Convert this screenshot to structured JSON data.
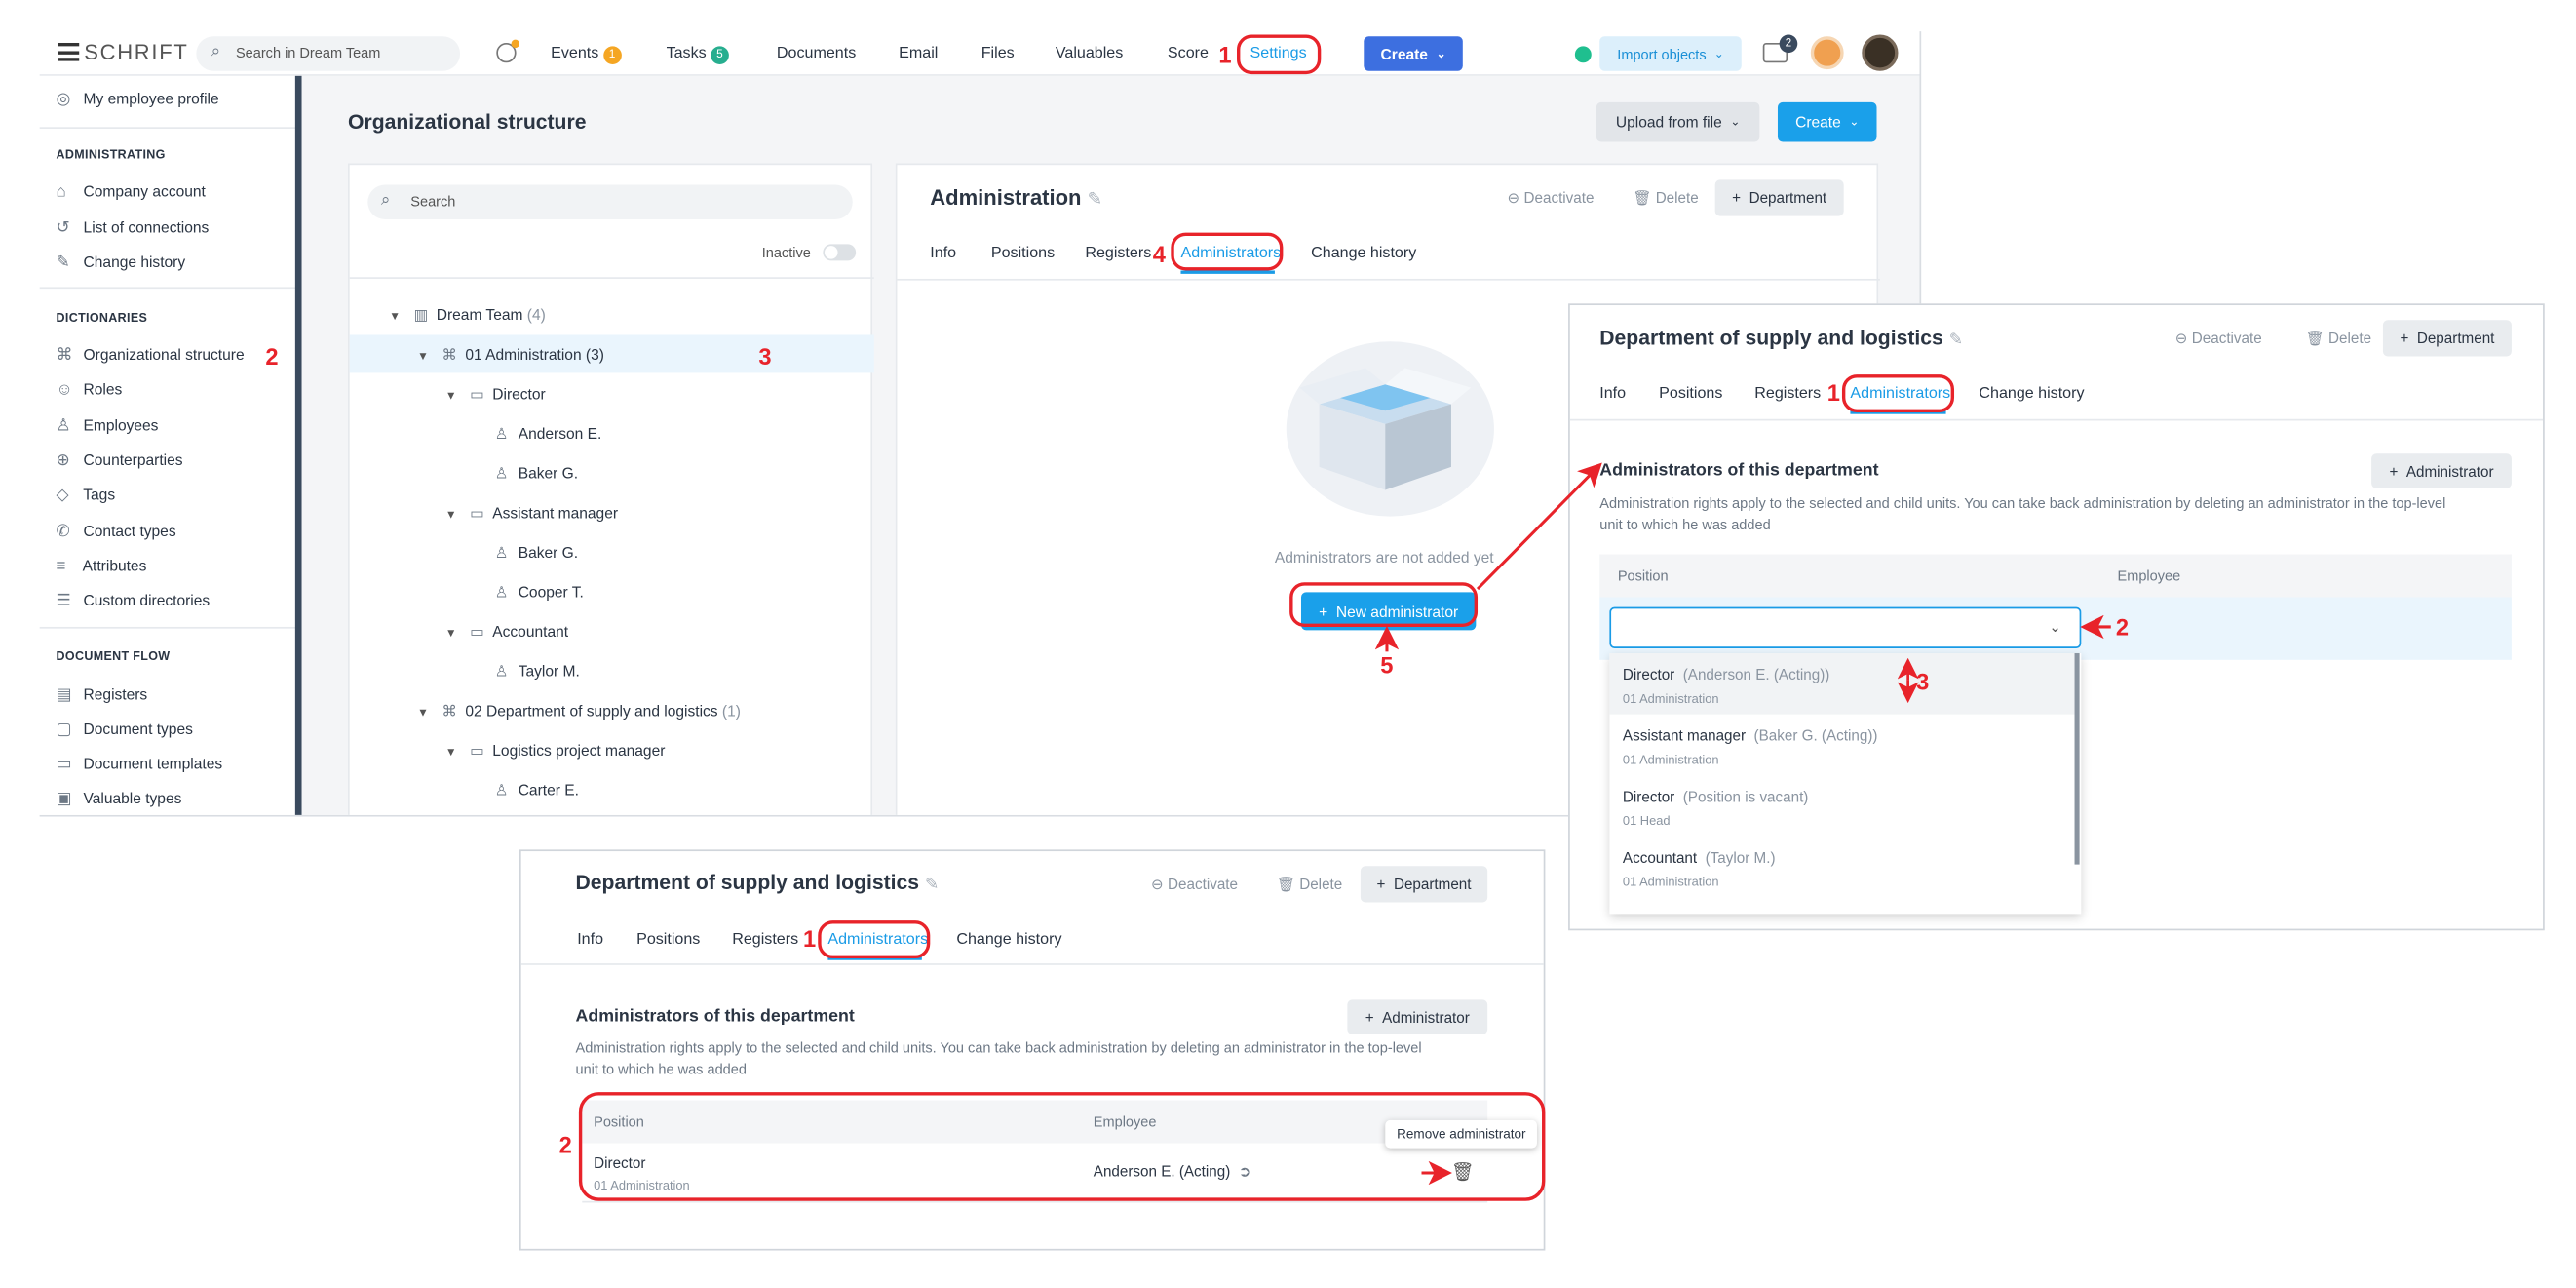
{
  "topbar": {
    "logo": "SCHRIFT",
    "search_placeholder": "Search in Dream Team",
    "nav": [
      {
        "label": "Events",
        "badge": "1",
        "badge_color": "#f5a623"
      },
      {
        "label": "Tasks",
        "badge": "5",
        "badge_color": "#27ae8f"
      },
      {
        "label": "Documents"
      },
      {
        "label": "Email"
      },
      {
        "label": "Files"
      },
      {
        "label": "Valuables"
      },
      {
        "label": "Score"
      },
      {
        "label": "Settings"
      }
    ],
    "create_label": "Create",
    "import_label": "Import objects",
    "bag_badge": "2"
  },
  "sidebar": {
    "profile": "My employee profile",
    "sections": [
      {
        "header": "ADMINISTRATING",
        "items": [
          "Company account",
          "List of connections",
          "Change history"
        ]
      },
      {
        "header": "DICTIONARIES",
        "items": [
          "Organizational structure",
          "Roles",
          "Employees",
          "Counterparties",
          "Tags",
          "Contact types",
          "Attributes",
          "Custom directories"
        ]
      },
      {
        "header": "DOCUMENT FLOW",
        "items": [
          "Registers",
          "Document types",
          "Document templates",
          "Valuable types"
        ]
      }
    ]
  },
  "main": {
    "title": "Organizational structure",
    "upload_label": "Upload from file",
    "create_label": "Create"
  },
  "tree_panel": {
    "search_placeholder": "Search",
    "inactive_label": "Inactive",
    "nodes": [
      {
        "label": "Dream Team",
        "count": "(4)"
      },
      {
        "label": "01 Administration (3)"
      },
      {
        "label": "Director"
      },
      {
        "label": "Anderson E."
      },
      {
        "label": "Baker G."
      },
      {
        "label": "Assistant manager"
      },
      {
        "label": "Baker G."
      },
      {
        "label": "Cooper T."
      },
      {
        "label": "Accountant"
      },
      {
        "label": "Taylor M."
      },
      {
        "label": "02 Department of supply and logistics",
        "count": "(1)"
      },
      {
        "label": "Logistics project manager"
      },
      {
        "label": "Carter E."
      }
    ]
  },
  "detail": {
    "title": "Administration",
    "deactivate": "Deactivate",
    "delete": "Delete",
    "department": "Department",
    "tabs": [
      "Info",
      "Positions",
      "Registers",
      "Administrators",
      "Change history"
    ],
    "empty_text": "Administrators are not added yet",
    "new_admin": "New administrator"
  },
  "panel2": {
    "title": "Department of supply and logistics",
    "deactivate": "Deactivate",
    "delete": "Delete",
    "department": "Department",
    "tabs": [
      "Info",
      "Positions",
      "Registers",
      "Administrators",
      "Change history"
    ],
    "section_title": "Administrators of this department",
    "add_admin": "Administrator",
    "description": "Administration rights apply to the selected and child units. You can take back administration by deleting an administrator in the top-level unit to which he was added",
    "col_position": "Position",
    "col_employee": "Employee",
    "options": [
      {
        "position": "Director",
        "holder": "(Anderson E. (Acting))",
        "unit": "01 Administration"
      },
      {
        "position": "Assistant manager",
        "holder": "(Baker G. (Acting))",
        "unit": "01 Administration"
      },
      {
        "position": "Director",
        "holder": "(Position is vacant)",
        "unit": "01 Head"
      },
      {
        "position": "Accountant",
        "holder": "(Taylor M.)",
        "unit": "01 Administration"
      }
    ]
  },
  "panel3": {
    "title": "Department of supply and logistics",
    "deactivate": "Deactivate",
    "delete": "Delete",
    "department": "Department",
    "tabs": [
      "Info",
      "Positions",
      "Registers",
      "Administrators",
      "Change history"
    ],
    "section_title": "Administrators of this department",
    "add_admin": "Administrator",
    "description_line1": "Administration rights apply to the selected and child units. You can take back administration by deleting an administrator in the top-level",
    "description_line2": "unit to which he was added",
    "col_position": "Position",
    "col_employee": "Employee",
    "row_position": "Director",
    "row_unit": "01 Administration",
    "row_employee": "Anderson E. (Acting)",
    "tooltip": "Remove administrator"
  },
  "markers": {
    "m1": "1",
    "m2": "2",
    "m3": "3",
    "m4": "4",
    "m5": "5"
  },
  "colors": {
    "accent": "#1a9be6",
    "annotation": "#e8232a",
    "button": "#1aa0ea",
    "create": "#3d6fe0"
  }
}
